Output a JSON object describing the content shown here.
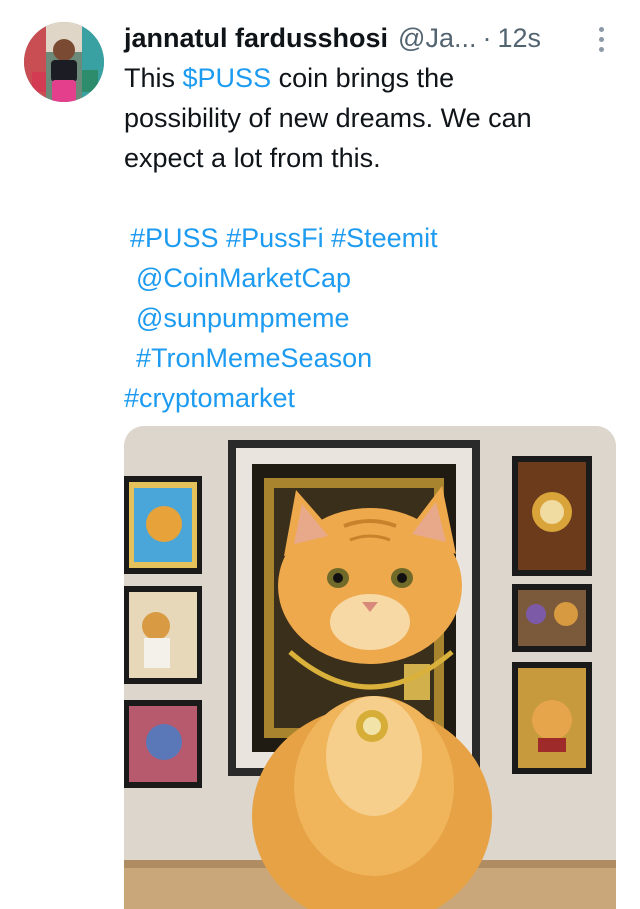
{
  "tweet": {
    "author_name": "jannatul fardusshosi",
    "handle": "@Ja...",
    "separator": "·",
    "time": "12s",
    "text_lines": [
      "This",
      "$PUSS",
      "coin brings the",
      "possibility of new dreams.  We can",
      "expect a lot from this."
    ],
    "hashtags_line": [
      "#PUSS",
      "#PussFi",
      "#Steemit"
    ],
    "mention_1": "@CoinMarketCap",
    "mention_2": "@sunpumpmeme",
    "hashtag_tron": "#TronMemeSeason",
    "hashtag_crypto": "#cryptomarket"
  },
  "icons": {
    "more": "more-vertical-icon",
    "avatar": "profile-avatar"
  },
  "colors": {
    "link": "#1d9bf0",
    "text": "#0f1419",
    "muted": "#536471"
  }
}
